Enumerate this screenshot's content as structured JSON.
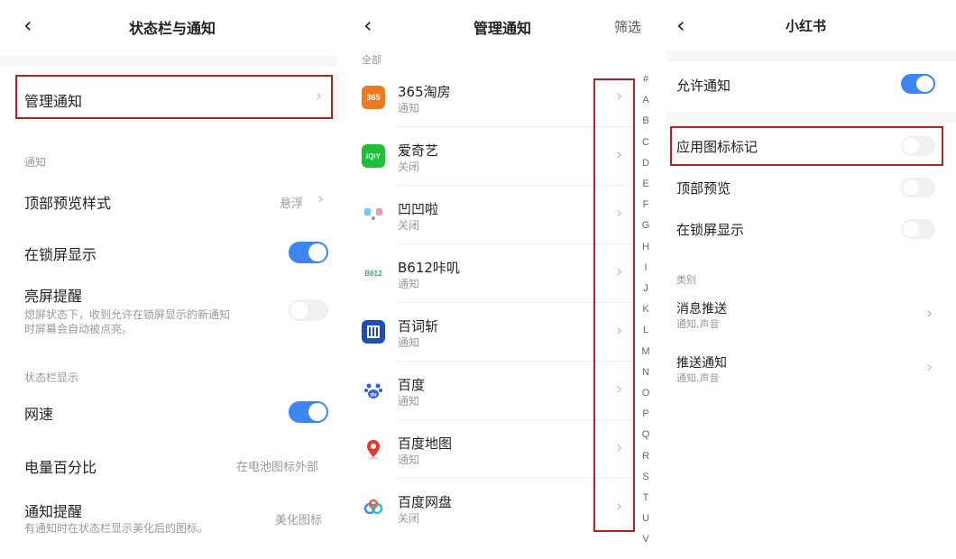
{
  "colors": {
    "accent": "#3b86f0",
    "highlight_box": "#b22222"
  },
  "panel1": {
    "title": "状态栏与通知",
    "manage_notifications": "管理通知",
    "section_notify": "通知",
    "top_preview_style": {
      "label": "顶部预览样式",
      "value": "悬浮"
    },
    "lockscreen_display": {
      "label": "在锁屏显示",
      "on": true
    },
    "screen_wake": {
      "label": "亮屏提醒",
      "desc_line1": "熄屏状态下，收到允许在锁屏显示的新通知",
      "desc_line2": "时屏幕会自动被点亮。",
      "on": false
    },
    "section_statusbar": "状态栏显示",
    "net_speed": {
      "label": "网速",
      "on": true
    },
    "battery_percent": {
      "label": "电量百分比",
      "value": "在电池图标外部"
    },
    "notify_remind": {
      "label": "通知提醒",
      "desc": "有通知时在状态栏显示美化后的图标。",
      "value": "美化图标"
    }
  },
  "panel2": {
    "title": "管理通知",
    "filter": "筛选",
    "section_all": "全部",
    "apps": [
      {
        "name": "365淘房",
        "status": "通知",
        "icon": "365-taofang-icon"
      },
      {
        "name": "爱奇艺",
        "status": "关闭",
        "icon": "iqiyi-icon"
      },
      {
        "name": "凹凹啦",
        "status": "关闭",
        "icon": "aoaola-icon"
      },
      {
        "name": "B612咔叽",
        "status": "通知",
        "icon": "b612-icon"
      },
      {
        "name": "百词斩",
        "status": "通知",
        "icon": "baicizhan-icon"
      },
      {
        "name": "百度",
        "status": "通知",
        "icon": "baidu-icon"
      },
      {
        "name": "百度地图",
        "status": "通知",
        "icon": "baidu-map-icon"
      },
      {
        "name": "百度网盘",
        "status": "关闭",
        "icon": "baidu-netdisk-icon"
      }
    ],
    "icon_texts": {
      "365": "365",
      "iqiyi": "iQIY",
      "b612": "B612",
      "baidu": "du"
    },
    "index_letters": [
      "#",
      "A",
      "B",
      "C",
      "D",
      "E",
      "F",
      "G",
      "H",
      "I",
      "J",
      "K",
      "L",
      "M",
      "N",
      "O",
      "P",
      "Q",
      "R",
      "S",
      "T",
      "U",
      "V"
    ]
  },
  "panel3": {
    "title": "小红书",
    "allow_notify": {
      "label": "允许通知",
      "on": true
    },
    "app_icon_badge": {
      "label": "应用图标标记",
      "on": false
    },
    "top_preview": {
      "label": "顶部预览",
      "on": false
    },
    "lockscreen_display": {
      "label": "在锁屏显示",
      "on": false
    },
    "section_category": "类别",
    "categories": [
      {
        "label": "消息推送",
        "desc": "通知,声音"
      },
      {
        "label": "推送通知",
        "desc": "通知,声音"
      }
    ]
  }
}
